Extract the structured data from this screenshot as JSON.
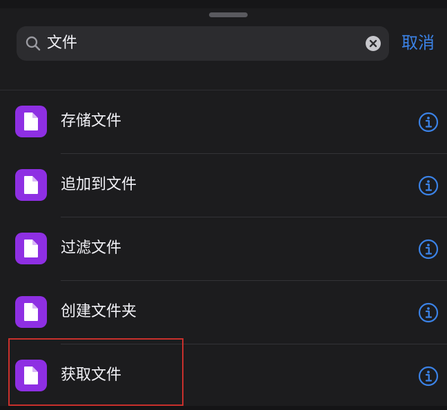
{
  "search": {
    "query": "文件",
    "cancel_label": "取消"
  },
  "actions": [
    {
      "label": "存储文件"
    },
    {
      "label": "追加到文件"
    },
    {
      "label": "过滤文件"
    },
    {
      "label": "创建文件夹"
    },
    {
      "label": "获取文件"
    }
  ],
  "colors": {
    "sheet_background": "#1c1c1e",
    "search_field": "#2c2c2f",
    "accent": "#3b82e6",
    "action_icon": "#8e2fe3",
    "highlight_outline": "#c9302c"
  },
  "icons": {
    "search": "search-icon",
    "clear": "clear-icon",
    "action": "document-icon",
    "info": "info-icon"
  }
}
